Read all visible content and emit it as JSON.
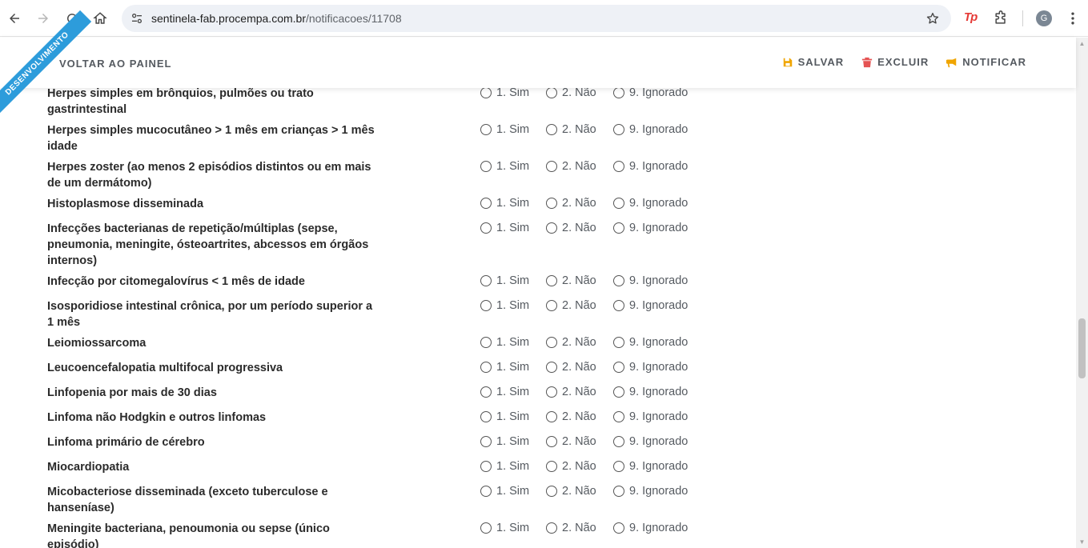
{
  "browser": {
    "url_host": "sentinela-fab.procempa.com.br",
    "url_path": "/notificacoes/11708",
    "extension_label": "Tp",
    "profile_initial": "G"
  },
  "header": {
    "ribbon": "DESENVOLVIMENTO",
    "back_label": "VOLTAR AO PAINEL",
    "actions": [
      {
        "label": "SALVAR",
        "icon": "save-icon",
        "color": "#f0a500"
      },
      {
        "label": "EXCLUIR",
        "icon": "trash-icon",
        "color": "#e55353"
      },
      {
        "label": "NOTIFICAR",
        "icon": "bullhorn-icon",
        "color": "#f0a500"
      }
    ]
  },
  "options": [
    "1. Sim",
    "2. Não",
    "9. Ignorado"
  ],
  "rows": [
    {
      "label": "Herpes simples em brônquios, pulmões ou trato gastrintestinal",
      "lines": 2
    },
    {
      "label": "Herpes simples mucocutâneo > 1 mês em crianças > 1 mês idade",
      "lines": 2
    },
    {
      "label": "Herpes zoster (ao menos 2 episódios distintos ou em mais de um dermátomo)",
      "lines": 2
    },
    {
      "label": "Histoplasmose disseminada",
      "lines": 1
    },
    {
      "label": "Infecções bacterianas de repetição/múltiplas (sepse, pneumonia, meningite, ósteoartrites, abcessos em órgãos internos)",
      "lines": 3
    },
    {
      "label": "Infecção por citomegalovírus < 1 mês de idade",
      "lines": 1
    },
    {
      "label": "Isosporidiose intestinal crônica, por um período superior a 1 mês",
      "lines": 2
    },
    {
      "label": "Leiomiossarcoma",
      "lines": 1
    },
    {
      "label": "Leucoencefalopatia multifocal progressiva",
      "lines": 1
    },
    {
      "label": "Linfopenia por mais de 30 dias",
      "lines": 1
    },
    {
      "label": "Linfoma não Hodgkin e outros linfomas",
      "lines": 1
    },
    {
      "label": "Linfoma primário de cérebro",
      "lines": 1
    },
    {
      "label": "Miocardiopatia",
      "lines": 1
    },
    {
      "label": "Micobacteriose disseminada (exceto tuberculose e hanseníase)",
      "lines": 2
    },
    {
      "label": "Meningite bacteriana, penoumonia ou sepse (único episódio)",
      "lines": 2
    }
  ]
}
